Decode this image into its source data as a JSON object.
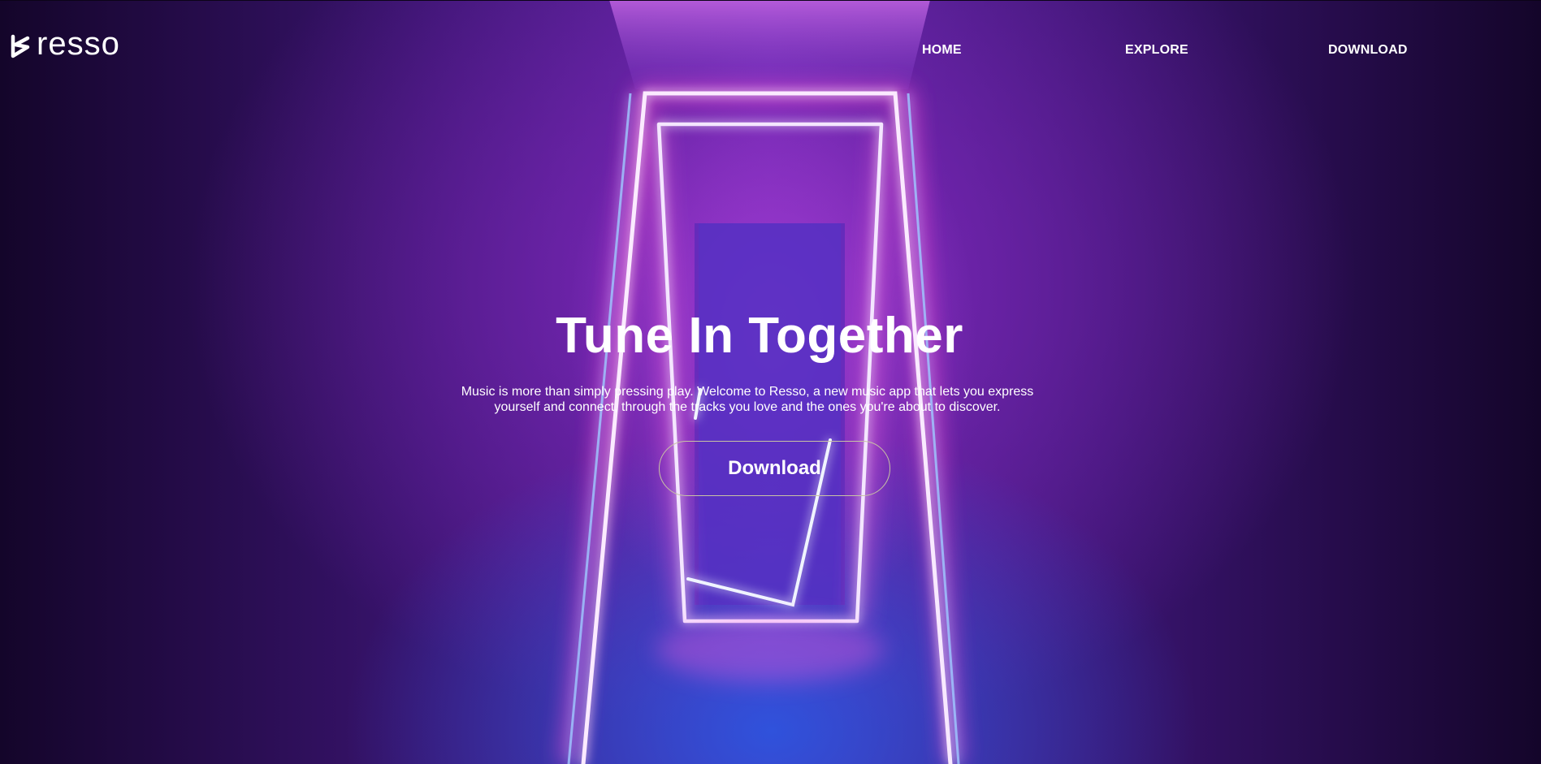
{
  "brand": {
    "name": "resso",
    "logo_icon": "resso-logo-icon"
  },
  "nav": {
    "home": "HOME",
    "explore": "EXPLORE",
    "download": "DOWNLOAD"
  },
  "hero": {
    "title": "Tune In Together",
    "description": "Music is more than simply pressing play. Welcome to Resso, a new music app that lets you express yourself and connect, through the tracks you love and the ones you're about to discover.",
    "cta_label": "Download"
  },
  "colors": {
    "text": "#ffffff",
    "cta_border": "#c9c3a4",
    "neon_pink": "#ff4fd8",
    "neon_blue": "#6fa8ff",
    "background_dark": "#14052a"
  }
}
